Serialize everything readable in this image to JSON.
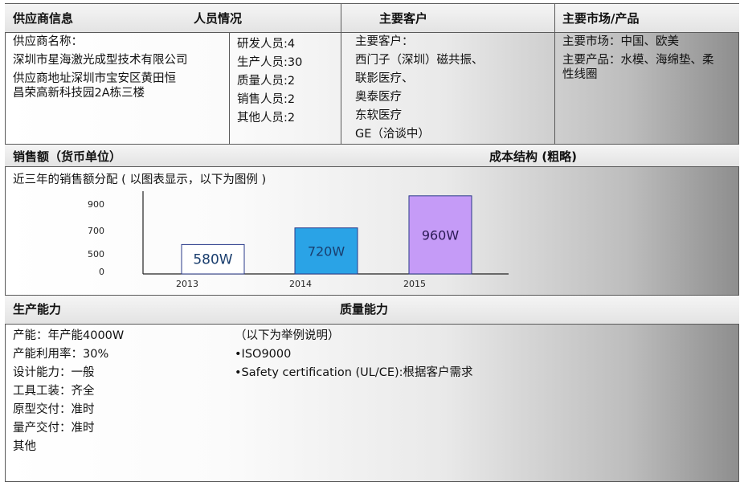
{
  "header": {
    "supplier_info": "供应商信息",
    "staff": "人员情况",
    "customers": "主要客户",
    "market": "主要市场/产品"
  },
  "supplier": {
    "lines": [
      "供应商名称：",
      "深圳市星海激光成型技术有限公司",
      "供应商地址深圳市宝安区黄田恒",
      "昌荣高新科技园2A栋三楼"
    ]
  },
  "staff": {
    "lines": [
      "研发人员:4",
      "生产人员:30",
      "质量人员:2",
      "销售人员:2",
      "其他人员:2"
    ]
  },
  "customers": {
    "lines": [
      "主要客户：",
      "西门子（深圳）磁共振、",
      "联影医疗、",
      "奥泰医疗",
      "东软医疗",
      "GE（洽谈中）"
    ]
  },
  "market": {
    "lines": [
      "主要市场：中国、欧美",
      "主要产品：水模、海绵垫、柔",
      "性线圈"
    ]
  },
  "sales_bar": {
    "sales": "销售额（货币单位）",
    "cost": "成本结构 (粗略)"
  },
  "sales_note": "近三年的销售额分配 ( 以图表显示，以下为图例 )",
  "chart_data": {
    "type": "bar",
    "categories": [
      "2013",
      "2014",
      "2015"
    ],
    "values": [
      580,
      720,
      960
    ],
    "value_labels": [
      "580W",
      "720W",
      "960W"
    ],
    "yticks": [
      "900",
      "700",
      "500",
      "0"
    ],
    "colors": [
      "#ffffff",
      "#2aa3e6",
      "#c59bf7"
    ],
    "label_colors": [
      "#1a3e6e",
      "#1a3e6e",
      "#2b1a55"
    ]
  },
  "production_bar": {
    "capacity": "生产能力",
    "quality": "质量能力"
  },
  "capacity": {
    "lines": [
      "产能：年产能4000W",
      "产能利用率：30%",
      "设计能力：一般",
      "工具工装：齐全",
      "原型交付：准时",
      "量产交付：准时",
      "其他"
    ]
  },
  "quality": {
    "lines": [
      "（以下为举例说明）",
      "•ISO9000",
      "•Safety certification (UL/CE):根据客户需求"
    ]
  }
}
